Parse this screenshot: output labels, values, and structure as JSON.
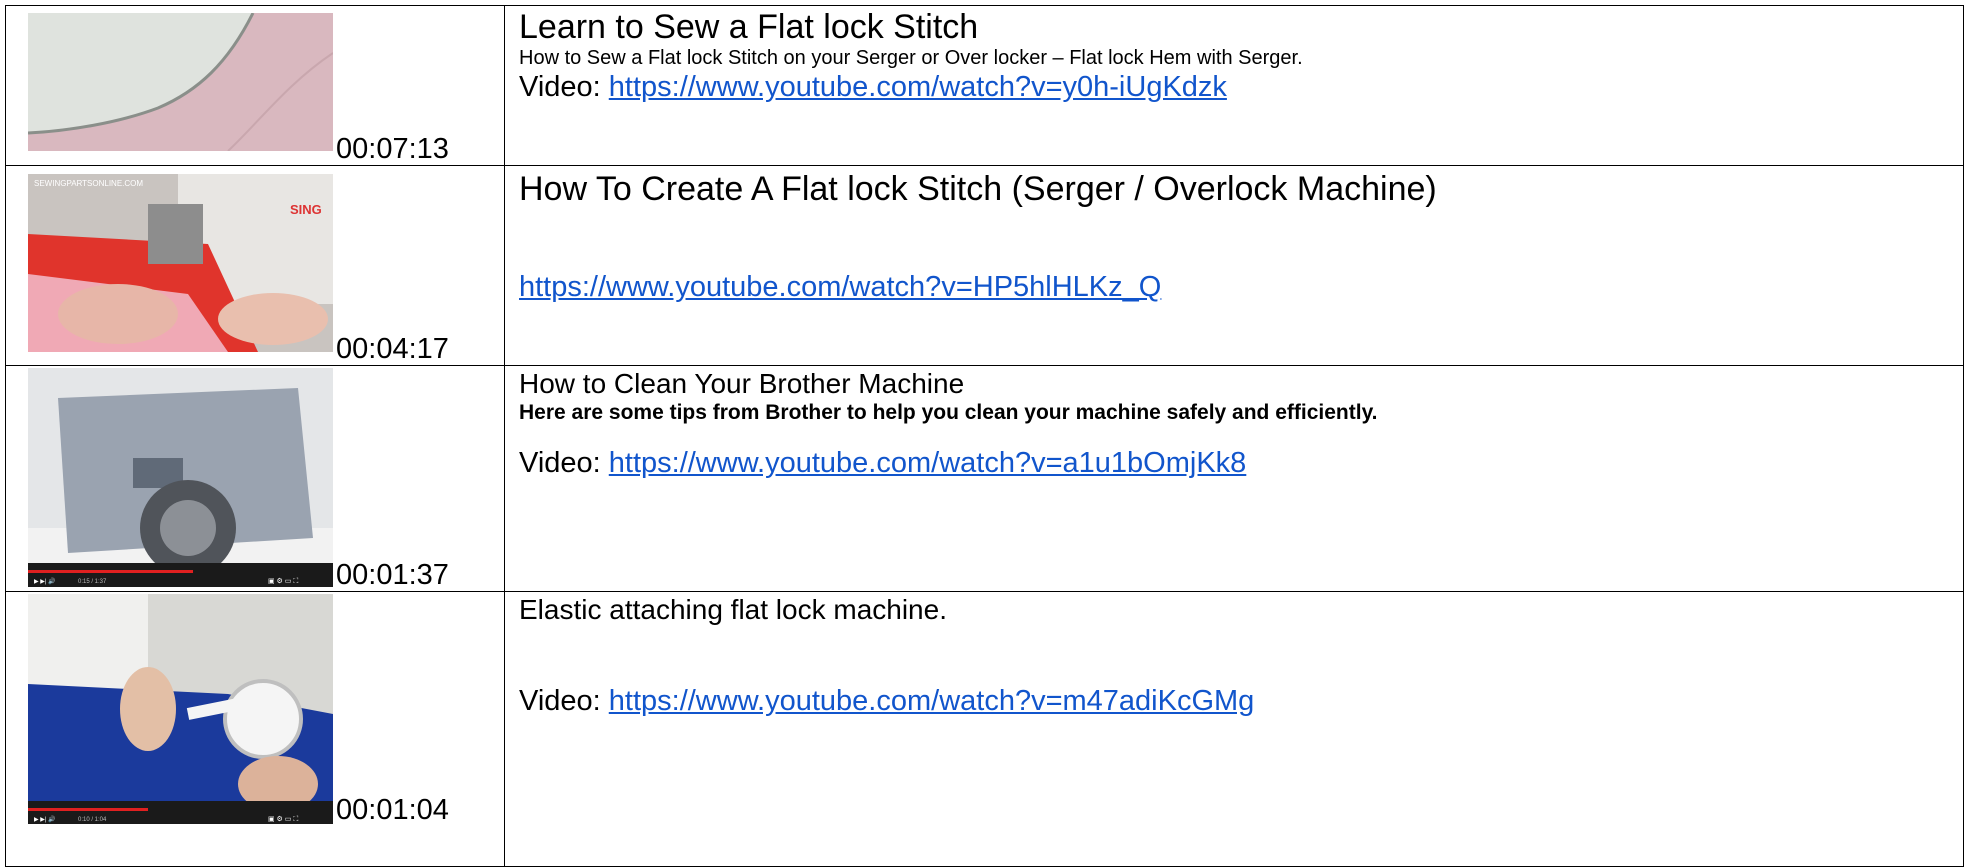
{
  "rows": [
    {
      "duration": "00:07:13",
      "title": "Learn to Sew a Flat lock Stitch",
      "description": "How to Sew a Flat lock Stitch on your Serger or Over locker – Flat lock Hem with Serger.",
      "video_prefix": "Video: ",
      "url": "https://www.youtube.com/watch?v=y0h-iUgKdzk",
      "thumb_icon": "fabric-thumbnail"
    },
    {
      "duration": "00:04:17",
      "title": "How To Create A Flat lock Stitch (Serger / Overlock Machine)",
      "thumb_watermark": "SEWINGPARTSONLINE.COM",
      "thumb_brand": "SING",
      "url": "https://www.youtube.com/watch?v=HP5hlHLKz_Q",
      "thumb_icon": "serger-thumbnail"
    },
    {
      "duration": "00:01:37",
      "title": "How to Clean Your Brother Machine",
      "description": "Here are some tips from Brother to help you clean your machine safely and efficiently.",
      "video_prefix": "Video: ",
      "url": "https://www.youtube.com/watch?v=a1u1bOmjKk8",
      "thumb_icon": "bobbin-area-thumbnail",
      "thumb_player_time": "0:15 / 1:37"
    },
    {
      "duration": "00:01:04",
      "title": "Elastic attaching flat lock machine.",
      "video_prefix": "Video: ",
      "url": "https://www.youtube.com/watch?v=m47adiKcGMg",
      "thumb_icon": "elastic-machine-thumbnail",
      "thumb_player_time": "0:10 / 1:04"
    }
  ]
}
